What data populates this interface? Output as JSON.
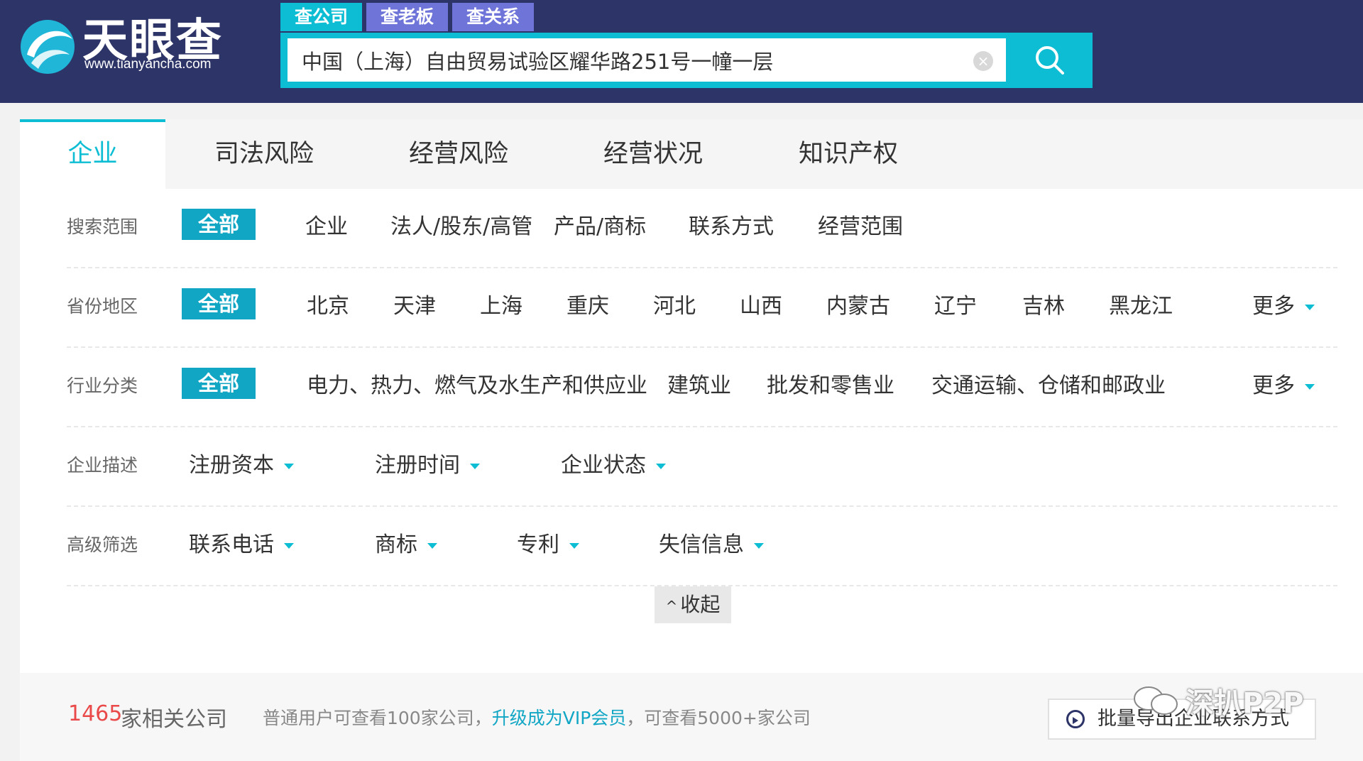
{
  "header": {
    "logo_name": "天眼查",
    "logo_url": "www.tianyancha.com",
    "search_tabs": [
      "查公司",
      "查老板",
      "查关系"
    ],
    "search_value": "中国（上海）自由贸易试验区耀华路251号一幢一层",
    "clear_symbol": "×"
  },
  "main_tabs": [
    "企业",
    "司法风险",
    "经营风险",
    "经营状况",
    "知识产权"
  ],
  "filters": {
    "scope": {
      "label": "搜索范围",
      "all": "全部",
      "options": [
        "企业",
        "法人/股东/高管",
        "产品/商标",
        "联系方式",
        "经营范围"
      ]
    },
    "region": {
      "label": "省份地区",
      "all": "全部",
      "options": [
        "北京",
        "天津",
        "上海",
        "重庆",
        "河北",
        "山西",
        "内蒙古",
        "辽宁",
        "吉林",
        "黑龙江"
      ],
      "more": "更多"
    },
    "industry": {
      "label": "行业分类",
      "all": "全部",
      "options": [
        "电力、热力、燃气及水生产和供应业",
        "建筑业",
        "批发和零售业",
        "交通运输、仓储和邮政业"
      ],
      "more": "更多"
    },
    "desc": {
      "label": "企业描述",
      "dropdowns": [
        "注册资本",
        "注册时间",
        "企业状态"
      ]
    },
    "advanced": {
      "label": "高级筛选",
      "dropdowns": [
        "联系电话",
        "商标",
        "专利",
        "失信信息"
      ]
    },
    "collapse": "收起",
    "collapse_glyph": "^"
  },
  "results": {
    "count": "1465",
    "count_label": "家相关公司",
    "notice_pre": "普通用户可查看100家公司，",
    "notice_link": "升级成为VIP会员",
    "notice_post": "，可查看5000+家公司",
    "export_label": "批量导出企业联系方式"
  },
  "watermark": "深扒P2P",
  "colors": {
    "header_bg": "#2d3468",
    "accent": "#0cbdd3",
    "tab_purple": "#6f74d9",
    "all_chip": "#12a6c5",
    "count_red": "#e94949"
  }
}
